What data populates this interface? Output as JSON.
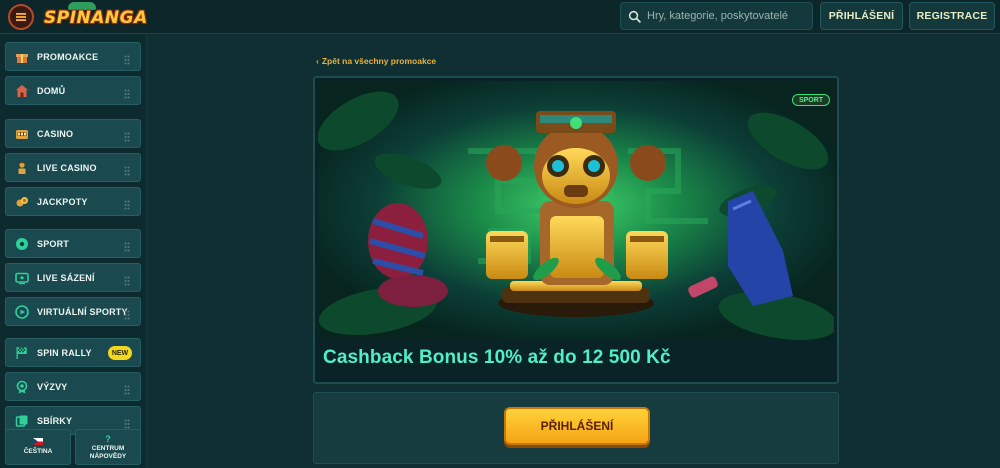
{
  "header": {
    "logo_text": "SPINANGA",
    "search_placeholder": "Hry, kategorie, poskytovatelé",
    "login_label": "PŘIHLÁŠENÍ",
    "register_label": "REGISTRACE"
  },
  "sidebar": {
    "items": [
      {
        "label": "PROMOAKCE",
        "icon": "gift-icon"
      },
      {
        "label": "DOMŮ",
        "icon": "home-icon"
      },
      {
        "label": "CASINO",
        "icon": "slot-machine-icon"
      },
      {
        "label": "LIVE CASINO",
        "icon": "dealer-icon"
      },
      {
        "label": "JACKPOTY",
        "icon": "coins-icon"
      },
      {
        "label": "SPORT",
        "icon": "soccer-ball-icon"
      },
      {
        "label": "LIVE SÁZENÍ",
        "icon": "live-tv-icon"
      },
      {
        "label": "VIRTUÁLNÍ SPORTY",
        "icon": "play-icon"
      },
      {
        "label": "SPIN RALLY",
        "icon": "race-flag-icon",
        "badge": "NEW"
      },
      {
        "label": "VÝZVY",
        "icon": "medal-icon"
      },
      {
        "label": "SBÍRKY",
        "icon": "collection-icon"
      }
    ],
    "language_label": "ČEŠTINA",
    "help_label_1": "CENTRUM",
    "help_label_2": "NÁPOVĚDY",
    "help_icon_glyph": "?"
  },
  "main": {
    "back_link": "Zpět na všechny promoakce",
    "tag": "SPORT",
    "promo_title": "Cashback Bonus 10% až do 12 500 Kč",
    "cta_label": "PŘIHLÁŠENÍ"
  },
  "colors": {
    "accent_teal": "#4ef0c4",
    "cta_yellow": "#ffd33a",
    "link_gold": "#e7b23b"
  }
}
